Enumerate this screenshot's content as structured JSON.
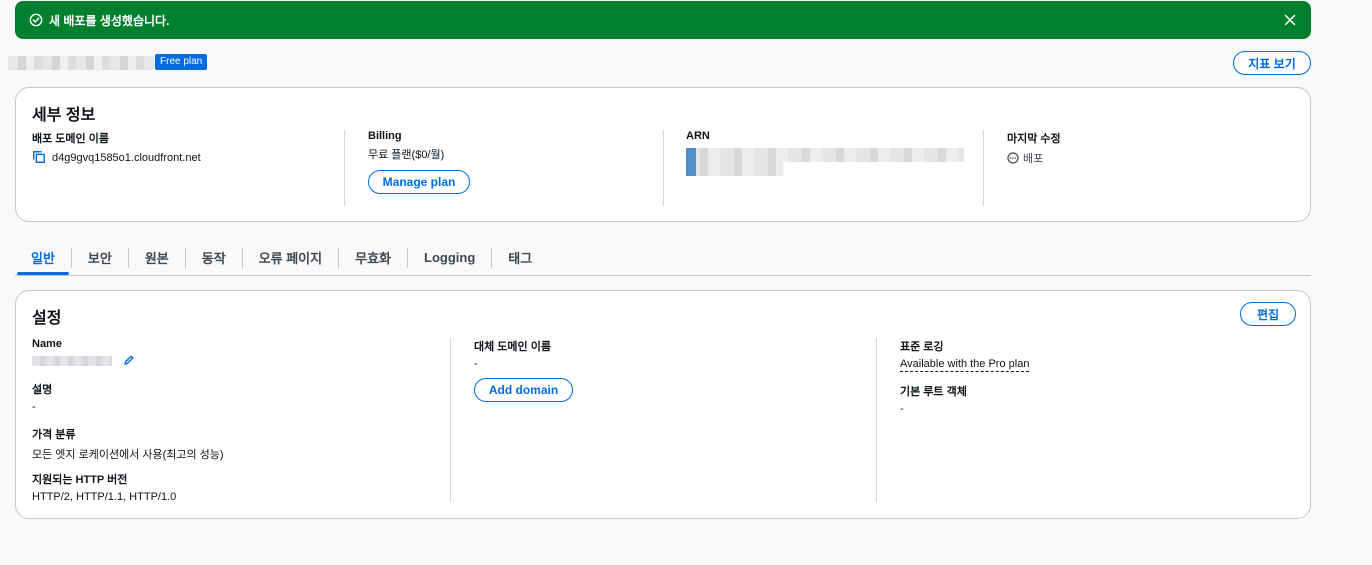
{
  "flash": {
    "message": "새 배포를 생성했습니다.",
    "type": "success",
    "icons": {
      "status": "check-circle-icon",
      "dismiss": "close-icon"
    }
  },
  "header": {
    "plan_badge": "Free plan",
    "metrics_button": "지표 보기"
  },
  "details": {
    "title": "세부 정보",
    "domain": {
      "label": "배포 도메인 이름",
      "value": "d4g9gvq1585o1.cloudfront.net"
    },
    "billing": {
      "label": "Billing",
      "value": "무료 플랜($0/월)",
      "button": "Manage plan"
    },
    "arn": {
      "label": "ARN"
    },
    "last_modified": {
      "label": "마지막 수정",
      "value": "배포"
    }
  },
  "tabs": [
    {
      "label": "일반",
      "active": true
    },
    {
      "label": "보안"
    },
    {
      "label": "원본"
    },
    {
      "label": "동작"
    },
    {
      "label": "오류 페이지"
    },
    {
      "label": "무효화"
    },
    {
      "label": "Logging"
    },
    {
      "label": "태그"
    }
  ],
  "settings": {
    "title": "설정",
    "edit_button": "편집",
    "name": {
      "label": "Name"
    },
    "description": {
      "label": "설명",
      "value": "-"
    },
    "price_class": {
      "label": "가격 분류",
      "value": "모든 엣지 로케이션에서 사용(최고의 성능)"
    },
    "http_versions": {
      "label": "지원되는 HTTP 버전",
      "value": "HTTP/2, HTTP/1.1, HTTP/1.0"
    },
    "alt_domains": {
      "label": "대체 도메인 이름",
      "value": "-",
      "button": "Add domain"
    },
    "standard_logging": {
      "label": "표준 로깅",
      "value": "Available with the Pro plan"
    },
    "default_root": {
      "label": "기본 루트 객체",
      "value": "-"
    }
  },
  "colors": {
    "success": "#00802f",
    "accent": "#006ce0",
    "border": "#c6c6cd"
  }
}
